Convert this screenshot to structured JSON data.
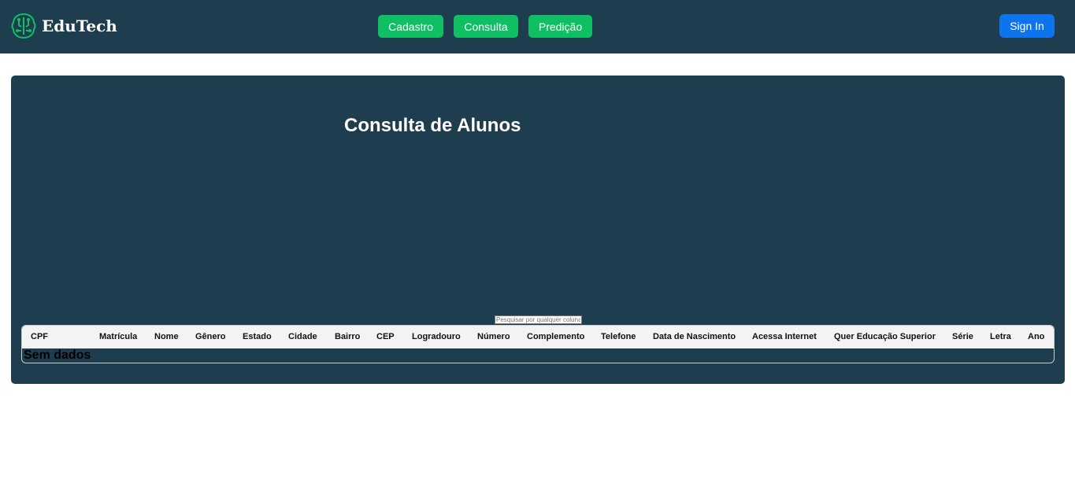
{
  "navbar": {
    "brand": "EduTech",
    "logo_icon": "brain-circuit-icon",
    "links": [
      "Cadastro",
      "Consulta",
      "Predição"
    ],
    "sign_in": "Sign In",
    "colors": {
      "background": "#1e3d4f",
      "nav_button": "#0fbf63",
      "sign_in": "#0d74ee"
    }
  },
  "main": {
    "title": "Consulta de Alunos",
    "search_placeholder": "Pesquisar por qualquer coluna",
    "columns": [
      "CPF",
      "Matrícula",
      "Nome",
      "Gênero",
      "Estado",
      "Cidade",
      "Bairro",
      "CEP",
      "Logradouro",
      "Número",
      "Complemento",
      "Telefone",
      "Data de Nascimento",
      "Acessa Internet",
      "Quer Educação Superior",
      "Série",
      "Letra",
      "Ano"
    ],
    "empty_message": "Sem dados"
  }
}
